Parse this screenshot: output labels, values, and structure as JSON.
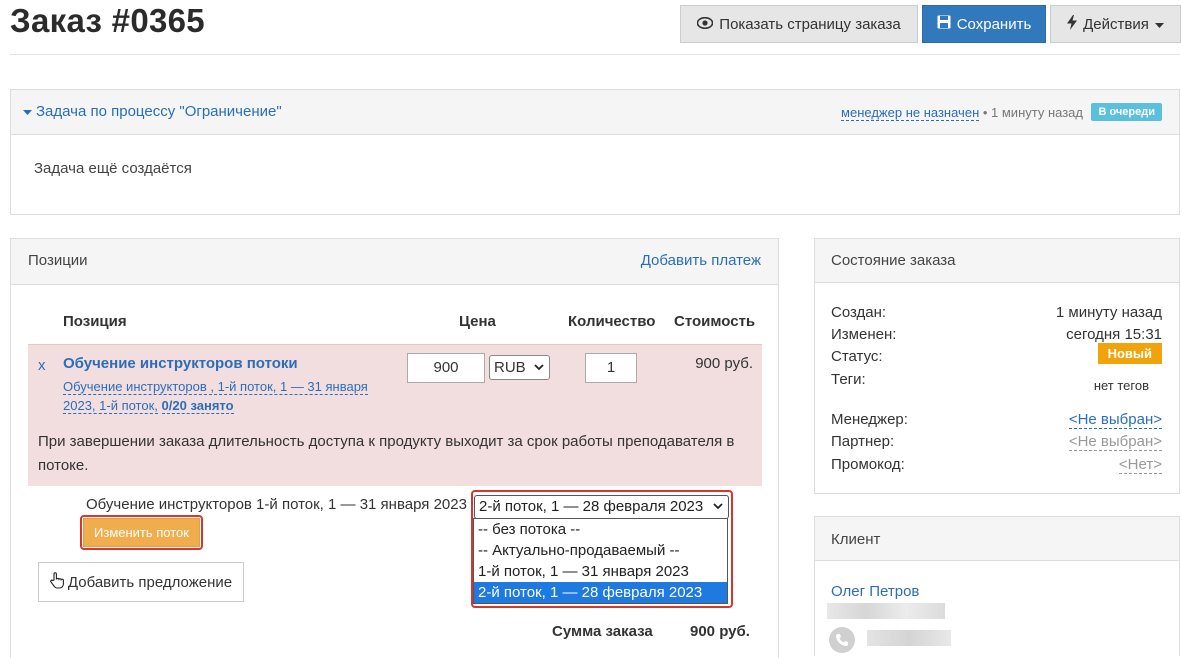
{
  "header": {
    "title": "Заказ #0365",
    "show_page_label": "Показать страницу заказа",
    "save_label": "Сохранить",
    "actions_label": "Действия"
  },
  "task": {
    "title": "Задача по процессу \"Ограничение\"",
    "manager_link": "менеджер не назначен",
    "time": " • 1 минуту назад",
    "badge": "В очереди",
    "body": "Задача ещё создаётся"
  },
  "positions": {
    "title": "Позиции",
    "add_payment": "Добавить платеж",
    "columns": [
      "Позиция",
      "Цена",
      "Количество",
      "Стоимость"
    ],
    "item": {
      "remove": "x",
      "name": "Обучение инструкторов потоки",
      "sub_link": "Обучение инструкторов , 1-й поток, 1 — 31 января 2023, 1-й поток,",
      "sub_count": "0/20 занято",
      "price": "900",
      "currency": "RUB",
      "quantity": "1",
      "cost": "900 руб.",
      "note": "При завершении заказа длительность доступа к продукту выходит за срок работы преподавателя в потоке."
    },
    "stream_label": "Обучение инструкторов 1-й поток, 1 — 31 января 2023",
    "change_stream": "Изменить поток",
    "add_offer": "Добавить предложение",
    "stream_select": {
      "selected": "2-й поток, 1 — 28 февраля 2023",
      "options": [
        "-- без потока --",
        "-- Актуально-продаваемый --",
        "1-й поток, 1 — 31 января 2023",
        "2-й поток, 1 — 28 февраля 2023"
      ]
    },
    "sum_label": "Сумма заказа",
    "sum_value": "900 руб."
  },
  "state": {
    "title": "Состояние заказа",
    "created_label": "Создан:",
    "created_value": "1 минуту назад",
    "modified_label": "Изменен:",
    "modified_value": "сегодня 15:31",
    "status_label": "Статус:",
    "status_value": "Новый",
    "tags_label": "Теги:",
    "tags_value": "нет тегов",
    "manager_label": "Менеджер:",
    "manager_value": "<Не выбран>",
    "partner_label": "Партнер:",
    "partner_value": "<Не выбран>",
    "promo_label": "Промокод:",
    "promo_value": "<Нет>"
  },
  "client": {
    "title": "Клиент",
    "name": "Олег Петров"
  },
  "colors": {
    "primary": "#3278bd",
    "link": "#2a6ebb",
    "warning": "#f0ad4e",
    "danger_frame": "#d9352f",
    "info_badge": "#5bc0de",
    "status_new": "#f0a30a",
    "row_bg": "#f2dede",
    "select_highlight": "#1e7ae0"
  },
  "icons": [
    "eye-icon",
    "save-icon",
    "bolt-icon",
    "caret-down-icon",
    "hand-pointer-icon",
    "phone-icon"
  ]
}
